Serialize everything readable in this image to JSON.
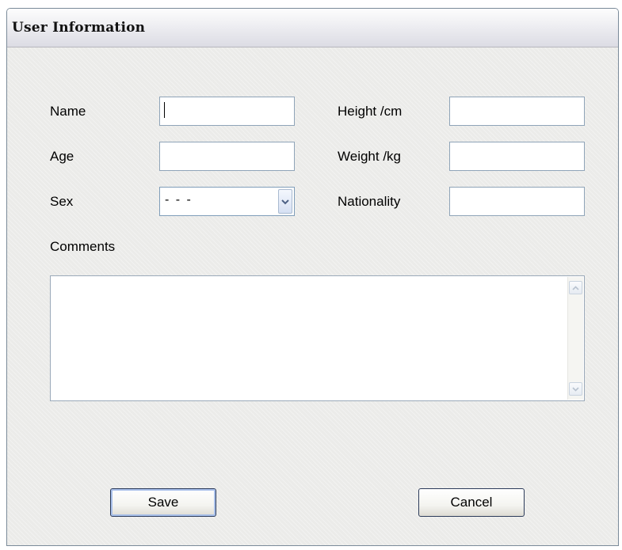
{
  "window": {
    "title": "User Information"
  },
  "form": {
    "labels": {
      "name": "Name",
      "age": "Age",
      "sex": "Sex",
      "height": "Height /cm",
      "weight": "Weight /kg",
      "nationality": "Nationality",
      "comments": "Comments"
    },
    "values": {
      "name": "",
      "age": "",
      "height": "",
      "weight": "",
      "nationality": "",
      "comments": ""
    },
    "sex_select": {
      "selected": "- - -"
    }
  },
  "buttons": {
    "save": "Save",
    "cancel": "Cancel"
  },
  "icons": {
    "dropdown": "chevron-down-icon",
    "scroll_up": "scroll-up-arrow-icon",
    "scroll_down": "scroll-down-arrow-icon"
  },
  "colors": {
    "input_border": "#8fa4b8",
    "button_border": "#2c3b5a",
    "default_button_focus": "#a9c0ea",
    "panel_background": "#ebebe9"
  }
}
